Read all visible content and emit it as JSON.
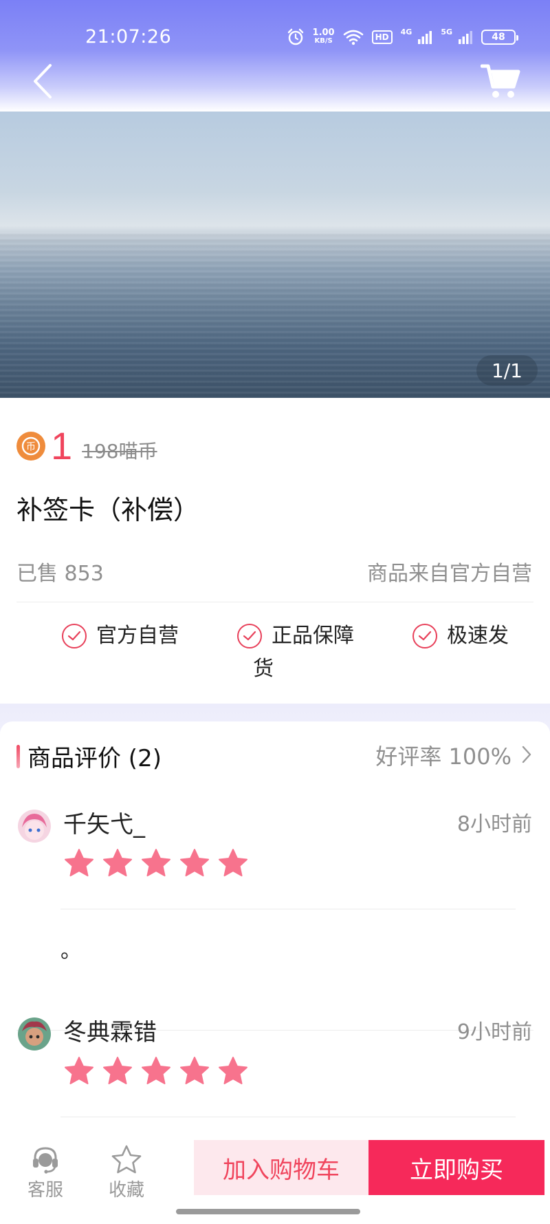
{
  "status_bar": {
    "time": "21:07:26",
    "net_speed_value": "1.00",
    "net_speed_unit": "KB/S",
    "hd_label": "HD",
    "sig1_label": "4G",
    "sig2_label": "5G",
    "battery": "48"
  },
  "header": {
    "back_icon": "chevron-left-icon",
    "cart_icon": "cart-icon"
  },
  "gallery": {
    "pager": "1/1"
  },
  "product": {
    "coin_symbol": "币",
    "price": "1",
    "original_price": "198喵币",
    "title": "补签卡（补偿）",
    "sold": "已售 853",
    "source": "商品来自官方自营"
  },
  "guarantees": [
    {
      "label": "官方自营"
    },
    {
      "label": "正品保障"
    },
    {
      "label": "极速发"
    },
    {
      "label": "货"
    }
  ],
  "reviews": {
    "title": "商品评价 (2)",
    "rate": "好评率 100%",
    "items": [
      {
        "name": "千矢弋_",
        "time": "8小时前",
        "stars": 5,
        "content": "。"
      },
      {
        "name": "冬典霖错",
        "time": "9小时前",
        "stars": 5,
        "content": ""
      }
    ]
  },
  "bottom_bar": {
    "service_label": "客服",
    "favorite_label": "收藏",
    "add_cart_label": "加入购物车",
    "buy_label": "立即购买"
  },
  "colors": {
    "accent": "#f0455d",
    "buy_button": "#f6295a",
    "star": "#f7738d",
    "header": "#7b80f6"
  }
}
